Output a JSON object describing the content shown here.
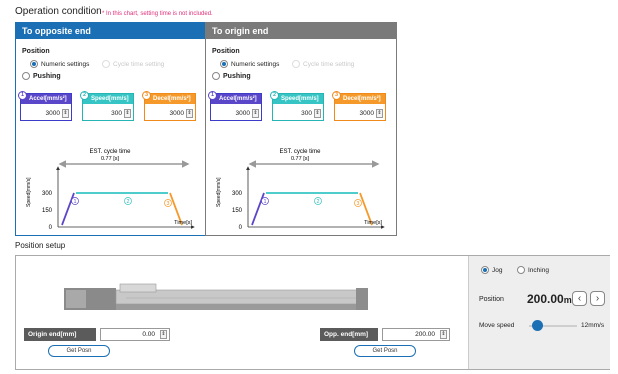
{
  "header": {
    "title": "Operation condition",
    "note": "* In this chart, setting time is not included."
  },
  "panels": [
    {
      "title": "To opposite end",
      "position_label": "Position",
      "numeric_label": "Numeric settings",
      "cycle_label": "Cycle time setting",
      "pushing_label": "Pushing",
      "accel": {
        "label": "Accel[mm/s²]",
        "value": "3000",
        "badge": "1"
      },
      "speed": {
        "label": "Speed[mm/s]",
        "value": "300",
        "badge": "2"
      },
      "decel": {
        "label": "Decel[mm/s²]",
        "value": "3000",
        "badge": "3"
      },
      "chart": {
        "est_label": "EST. cycle time",
        "est_value": "0.77 [s]",
        "y_label": "Speed[mm/s]",
        "x_label": "Time[s]",
        "y_ticks": [
          "300",
          "150",
          "0"
        ],
        "phases": [
          "1",
          "2",
          "3"
        ]
      }
    },
    {
      "title": "To origin end",
      "position_label": "Position",
      "numeric_label": "Numeric settings",
      "cycle_label": "Cycle time setting",
      "pushing_label": "Pushing",
      "accel": {
        "label": "Accel[mm/s²]",
        "value": "3000",
        "badge": "1"
      },
      "speed": {
        "label": "Speed[mm/s]",
        "value": "300",
        "badge": "2"
      },
      "decel": {
        "label": "Decel[mm/s²]",
        "value": "3000",
        "badge": "3"
      },
      "chart": {
        "est_label": "EST. cycle time",
        "est_value": "0.77 [s]",
        "y_label": "Speed[mm/s]",
        "x_label": "Time[s]",
        "y_ticks": [
          "300",
          "150",
          "0"
        ],
        "phases": [
          "1",
          "2",
          "3"
        ]
      }
    }
  ],
  "position_setup": {
    "title": "Position setup",
    "origin": {
      "label": "Origin end[mm]",
      "value": "0.00",
      "button": "Get Posn"
    },
    "opposite": {
      "label": "Opp. end[mm]",
      "value": "200.00",
      "button": "Get Posn"
    },
    "mode": {
      "jog": "Jog",
      "inching": "Inching"
    },
    "position_label": "Position",
    "position_value": "200.00",
    "position_unit": "mm",
    "move_speed_label": "Move speed",
    "move_speed_value": "12mm/s",
    "move_speed_level": 0.08
  },
  "colors": {
    "accent": "#1a6fb5",
    "phase1": "#5a46c8",
    "phase2": "#36c4c4",
    "phase3": "#f59a2a",
    "note": "#e0307a"
  },
  "icons": [
    "chevron-left-icon",
    "chevron-right-icon",
    "spin-up-down-icon",
    "actuator-image"
  ]
}
